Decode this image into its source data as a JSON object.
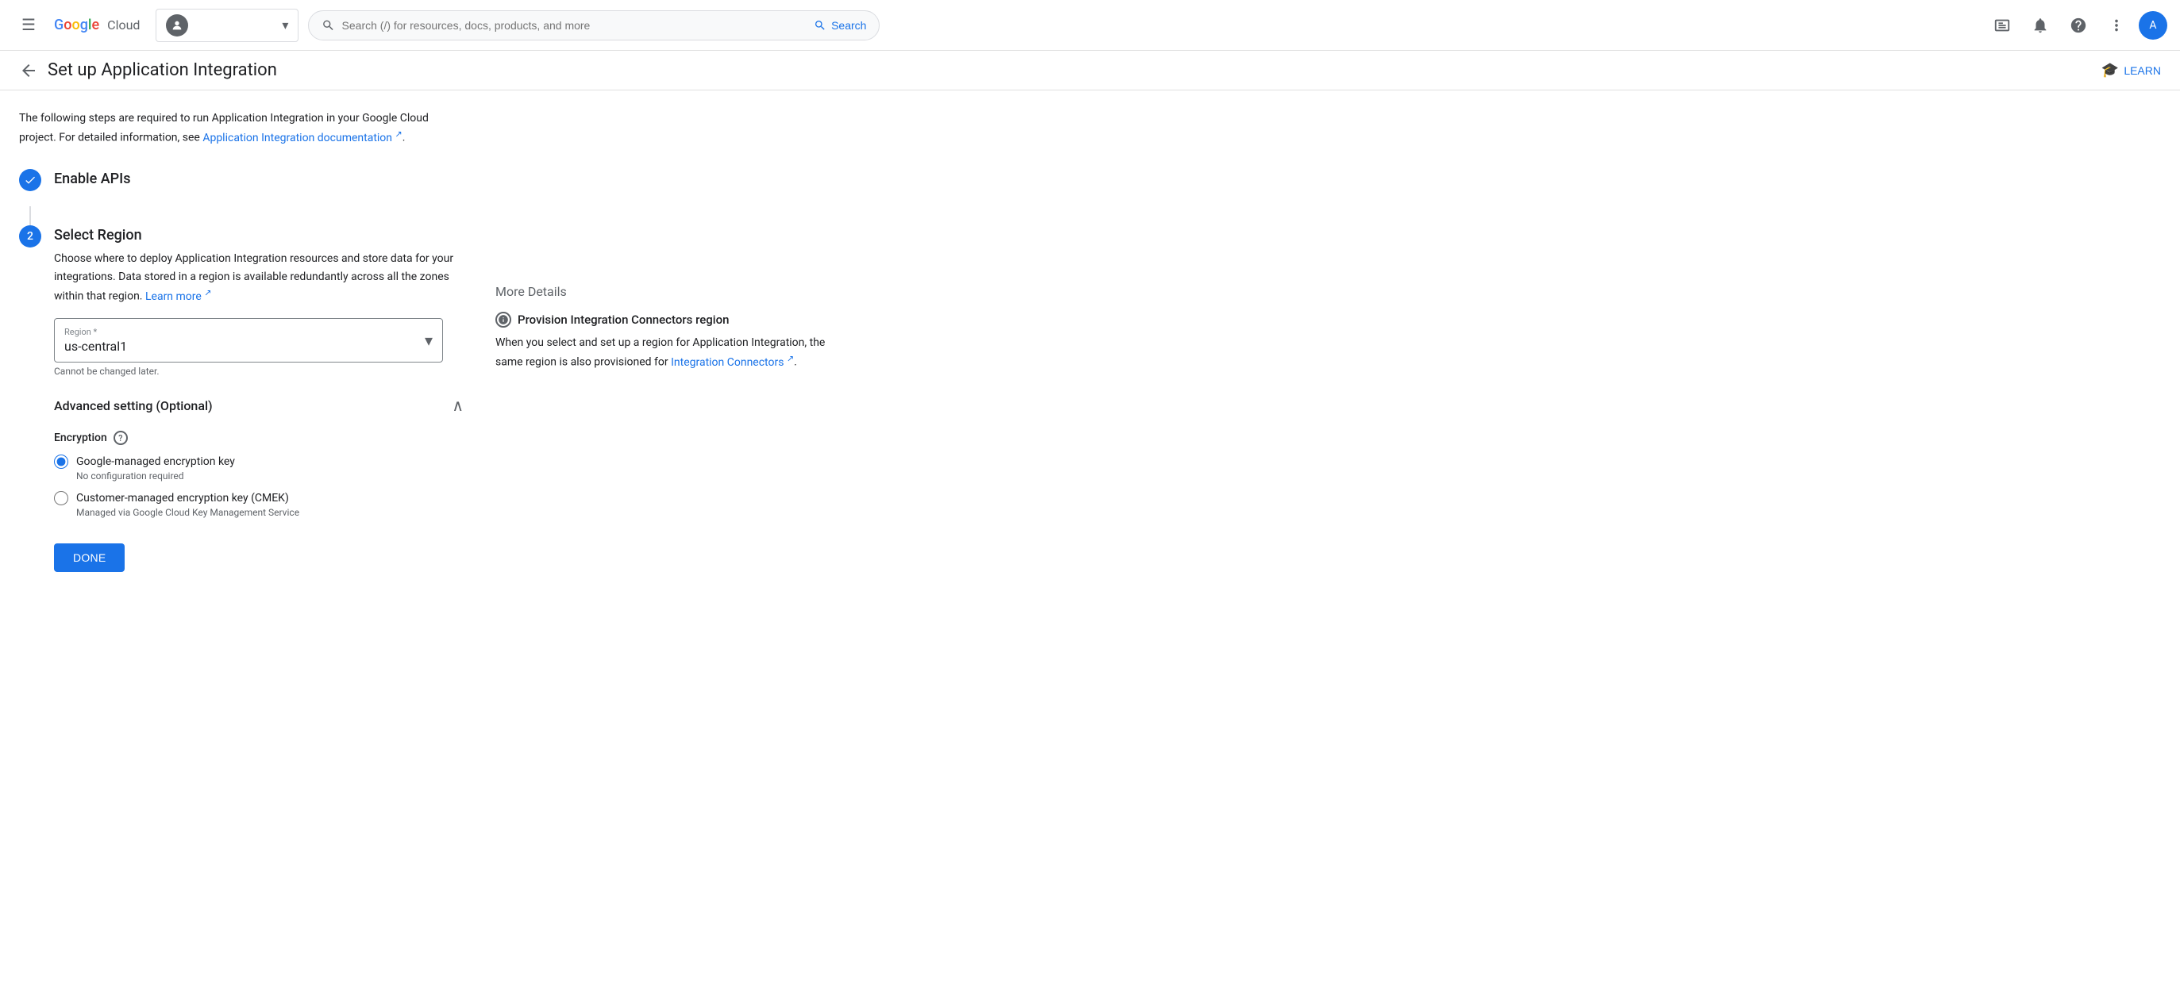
{
  "nav": {
    "menu_icon": "☰",
    "logo_text": {
      "g": "G",
      "o1": "o",
      "o2": "o",
      "g2": "g",
      "l": "l",
      "e": "e",
      "cloud": " Cloud"
    },
    "search_placeholder": "Search (/) for resources, docs, products, and more",
    "search_label": "Search",
    "terminal_icon": "⬜",
    "bell_icon": "🔔",
    "help_icon": "?",
    "dots_icon": "⋮",
    "user_initial": "A"
  },
  "breadcrumb": {
    "back_icon": "←",
    "title": "Set up Application Integration",
    "learn_label": "LEARN",
    "cap_icon": "🎓"
  },
  "intro": {
    "text": "The following steps are required to run Application Integration in your Google Cloud project. For detailed information, see",
    "link_text": "Application Integration documentation",
    "text_after": "."
  },
  "steps": {
    "step1": {
      "title": "Enable APIs",
      "check_icon": "✓"
    },
    "step2": {
      "number": "2",
      "title": "Select Region",
      "desc": "Choose where to deploy Application Integration resources and store data for your integrations. Data stored in a region is available redundantly across all the zones within that region.",
      "learn_more": "Learn more",
      "region_label": "Region *",
      "region_value": "us-central1",
      "region_hint": "Cannot be changed later.",
      "dropdown_arrow": "▼"
    }
  },
  "advanced": {
    "title": "Advanced setting (Optional)",
    "collapse_icon": "∧",
    "encryption": {
      "label": "Encryption",
      "options": [
        {
          "id": "google-managed",
          "label": "Google-managed encryption key",
          "sub": "No configuration required",
          "checked": true
        },
        {
          "id": "cmek",
          "label": "Customer-managed encryption key (CMEK)",
          "sub": "Managed via Google Cloud Key Management Service",
          "checked": false
        }
      ]
    }
  },
  "done_button": "DONE",
  "right_panel": {
    "more_details": "More Details",
    "connector_title": "Provision Integration Connectors region",
    "connector_desc": "When you select and set up a region for Application Integration, the same region is also provisioned for",
    "connector_link": "Integration Connectors",
    "connector_desc_after": "."
  }
}
